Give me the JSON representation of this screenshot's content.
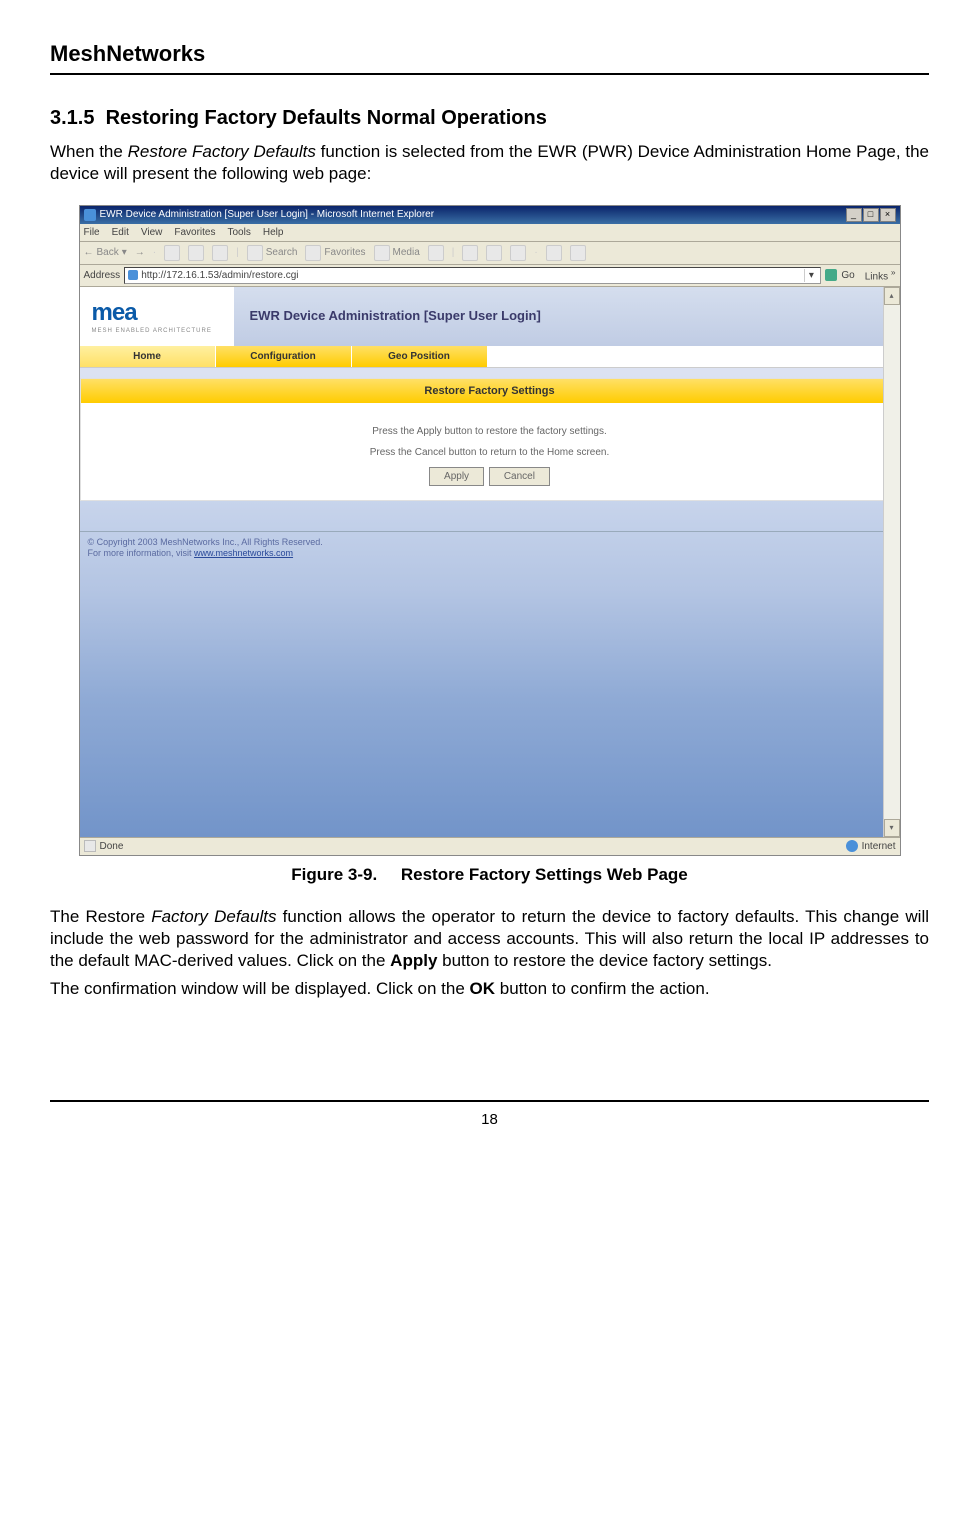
{
  "doc": {
    "brand": "MeshNetworks",
    "section_num": "3.1.5",
    "section_title": "Restoring Factory Defaults Normal Operations",
    "intro_1": "When the ",
    "intro_italic": "Restore Factory Defaults",
    "intro_2": " function is selected from the EWR (PWR) Device Administration Home Page, the device will present the following web page:",
    "fig_label": "Figure 3-9.",
    "fig_title": "Restore Factory Settings Web Page",
    "para2_a": "The Restore ",
    "para2_i": "Factory Defaults",
    "para2_b": " function allows the operator to return the device to factory defaults. This change will include the web password for the administrator and access accounts. This will also return the local IP addresses to the default MAC-derived values.  Click on the ",
    "para2_bold": "Apply",
    "para2_c": " button to restore the device factory settings.",
    "para3_a": "The confirmation window will be displayed. Click on the ",
    "para3_bold": "OK",
    "para3_b": " button to confirm the action.",
    "page_num": "18"
  },
  "ie": {
    "title": "EWR Device Administration [Super User Login] - Microsoft Internet Explorer",
    "menu": [
      "File",
      "Edit",
      "View",
      "Favorites",
      "Tools",
      "Help"
    ],
    "tb_back": "Back",
    "tb_search": "Search",
    "tb_fav": "Favorites",
    "tb_media": "Media",
    "addr_label": "Address",
    "addr_url": "http://172.16.1.53/admin/restore.cgi",
    "go": "Go",
    "links": "Links",
    "status_done": "Done",
    "status_net": "Internet"
  },
  "page": {
    "logo": "mea",
    "logo_sub": "MESH ENABLED ARCHITECTURE",
    "admin_title": "EWR Device Administration [Super User Login]",
    "tabs": [
      "Home",
      "Configuration",
      "Geo Position"
    ],
    "panel_title": "Restore Factory Settings",
    "msg1": "Press the Apply button to restore the factory settings.",
    "msg2": "Press the Cancel button to return to the Home screen.",
    "btn_apply": "Apply",
    "btn_cancel": "Cancel",
    "copyright": "© Copyright 2003 MeshNetworks Inc., All Rights Reserved.",
    "copyright2a": "For more information, visit ",
    "copyright2b": "www.meshnetworks.com"
  }
}
